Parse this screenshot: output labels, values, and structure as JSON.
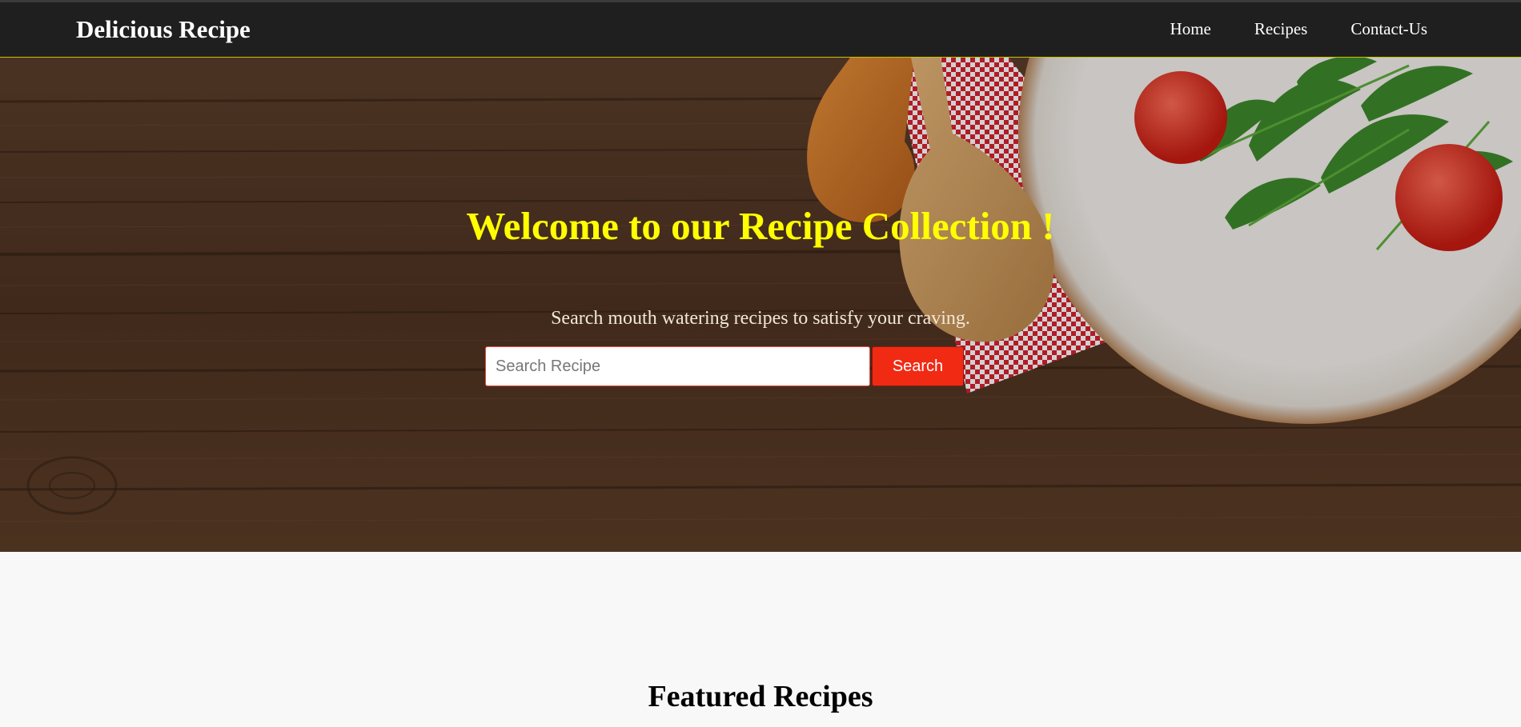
{
  "header": {
    "brand": "Delicious Recipe",
    "nav": [
      {
        "label": "Home"
      },
      {
        "label": "Recipes"
      },
      {
        "label": "Contact-Us"
      }
    ]
  },
  "hero": {
    "title": "Welcome to our Recipe Collection !",
    "subtitle": "Search mouth watering recipes to satisfy your craving.",
    "search": {
      "placeholder": "Search Recipe",
      "value": "",
      "button_label": "Search"
    }
  },
  "featured": {
    "title": "Featured Recipes"
  },
  "colors": {
    "header_bg": "#1f1f1f",
    "title_accent": "#ffff00",
    "search_button": "#f12a14",
    "page_bg": "#f8f8f8"
  }
}
